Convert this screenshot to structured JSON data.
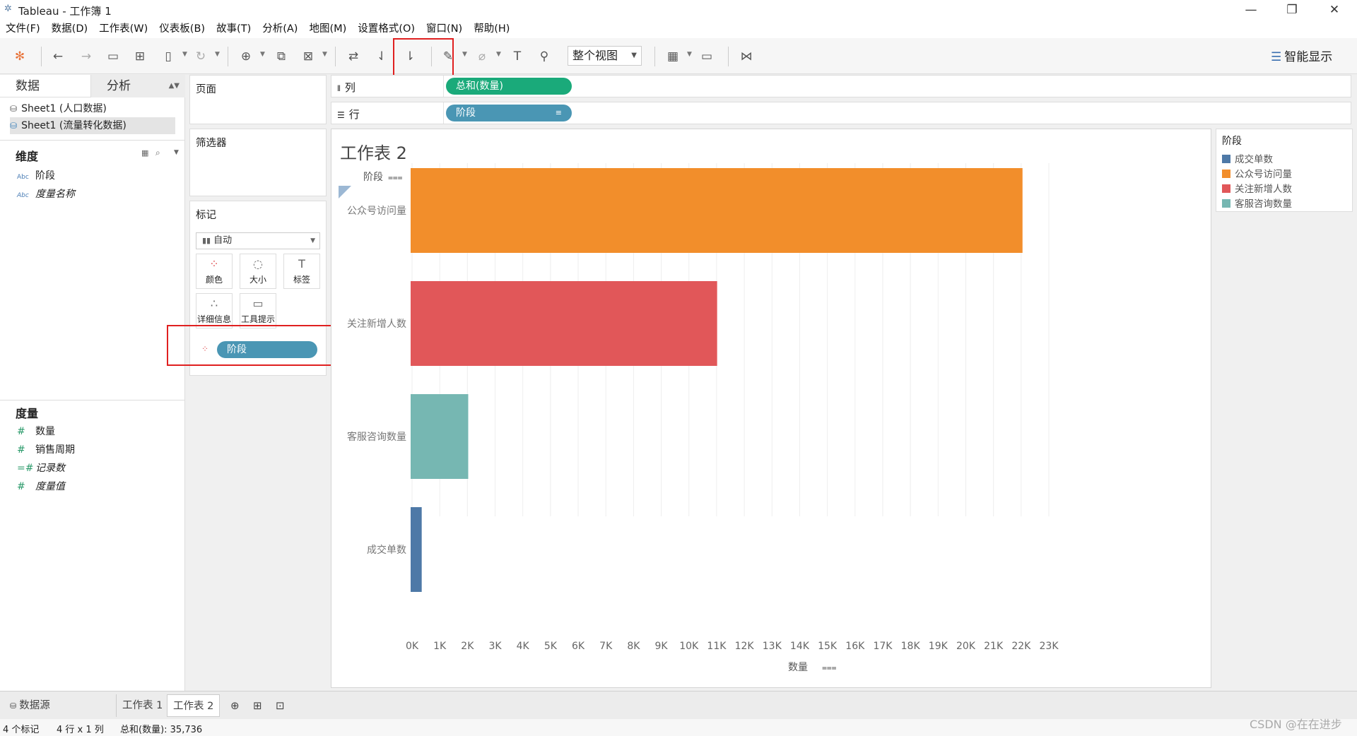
{
  "window": {
    "title": "Tableau - 工作簿 1"
  },
  "menu": [
    "文件(F)",
    "数据(D)",
    "工作表(W)",
    "仪表板(B)",
    "故事(T)",
    "分析(A)",
    "地图(M)",
    "设置格式(O)",
    "窗口(N)",
    "帮助(H)"
  ],
  "toolbar": {
    "view_mode": "整个视图",
    "smart_show": "智能显示"
  },
  "data_pane": {
    "tab_data": "数据",
    "tab_analysis": "分析",
    "sources": [
      "Sheet1 (人口数据)",
      "Sheet1 (流量转化数据)"
    ],
    "dimensions_title": "维度",
    "dimensions": [
      {
        "type": "Abc",
        "name": "阶段"
      },
      {
        "type": "Abc",
        "name": "度量名称"
      }
    ],
    "measures_title": "度量",
    "measures": [
      {
        "type": "#",
        "name": "数量"
      },
      {
        "type": "#",
        "name": "销售周期"
      },
      {
        "type": "=#",
        "name": "记录数"
      },
      {
        "type": "#",
        "name": "度量值"
      }
    ]
  },
  "cards": {
    "pages": "页面",
    "filters": "筛选器",
    "marks": "标记",
    "mark_type": "自动",
    "buttons": [
      "颜色",
      "大小",
      "标签",
      "详细信息",
      "工具提示"
    ],
    "color_pill": "阶段"
  },
  "shelves": {
    "columns_label": "列",
    "columns_pill": "总和(数量)",
    "rows_label": "行",
    "rows_pill": "阶段"
  },
  "sheet": {
    "title": "工作表 2",
    "row_header": "阶段",
    "x_axis_title": "数量"
  },
  "chart_data": {
    "type": "bar",
    "orientation": "horizontal",
    "categories": [
      "公众号访问量",
      "关注新增人数",
      "客服咨询数量",
      "成交单数"
    ],
    "values": [
      22100,
      11070,
      2080,
      400
    ],
    "colors": [
      "#f28e2b",
      "#e15759",
      "#76b7b2",
      "#4e79a7"
    ],
    "xlim": [
      0,
      23000
    ],
    "x_ticks": [
      "0K",
      "1K",
      "2K",
      "3K",
      "4K",
      "5K",
      "6K",
      "7K",
      "8K",
      "9K",
      "10K",
      "11K",
      "12K",
      "13K",
      "14K",
      "15K",
      "16K",
      "17K",
      "18K",
      "19K",
      "20K",
      "21K",
      "22K",
      "23K"
    ],
    "xlabel": "数量",
    "ylabel": "阶段",
    "grid": true
  },
  "legend": {
    "title": "阶段",
    "items": [
      {
        "label": "成交单数",
        "color": "#4e79a7"
      },
      {
        "label": "公众号访问量",
        "color": "#f28e2b"
      },
      {
        "label": "关注新增人数",
        "color": "#e15759"
      },
      {
        "label": "客服咨询数量",
        "color": "#76b7b2"
      }
    ]
  },
  "tabs": {
    "datasource": "数据源",
    "sheet1": "工作表 1",
    "sheet2": "工作表 2"
  },
  "status": {
    "marks": "4 个标记",
    "grid": "4 行 x 1 列",
    "sum": "总和(数量): 35,736"
  },
  "watermark": "CSDN @在在进步"
}
